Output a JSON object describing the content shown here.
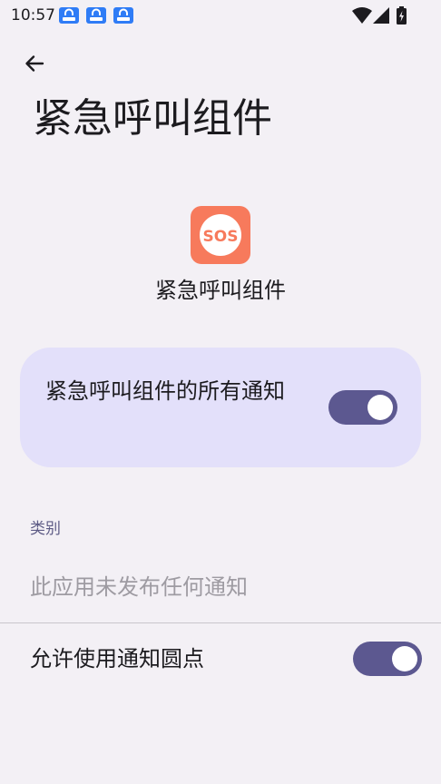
{
  "status_bar": {
    "time": "10:57",
    "notification_icons": [
      "amap-icon",
      "amap-icon",
      "amap-icon"
    ]
  },
  "header": {
    "back_icon": "arrow-back-icon",
    "title": "紧急呼叫组件"
  },
  "app": {
    "icon_text": "SOS",
    "name": "紧急呼叫组件",
    "icon_color": "#f77a5c"
  },
  "all_notifications": {
    "label": "紧急呼叫组件的所有通知",
    "enabled": true
  },
  "categories": {
    "header": "类别",
    "empty_message": "此应用未发布任何通知"
  },
  "notification_dot": {
    "label": "允许使用通知圆点",
    "enabled": true
  },
  "colors": {
    "background": "#f3f0f5",
    "card": "#e3e0fa",
    "toggle_track": "#5c5890",
    "section_header": "#5e5c86",
    "sos_icon": "#f77a5c"
  }
}
